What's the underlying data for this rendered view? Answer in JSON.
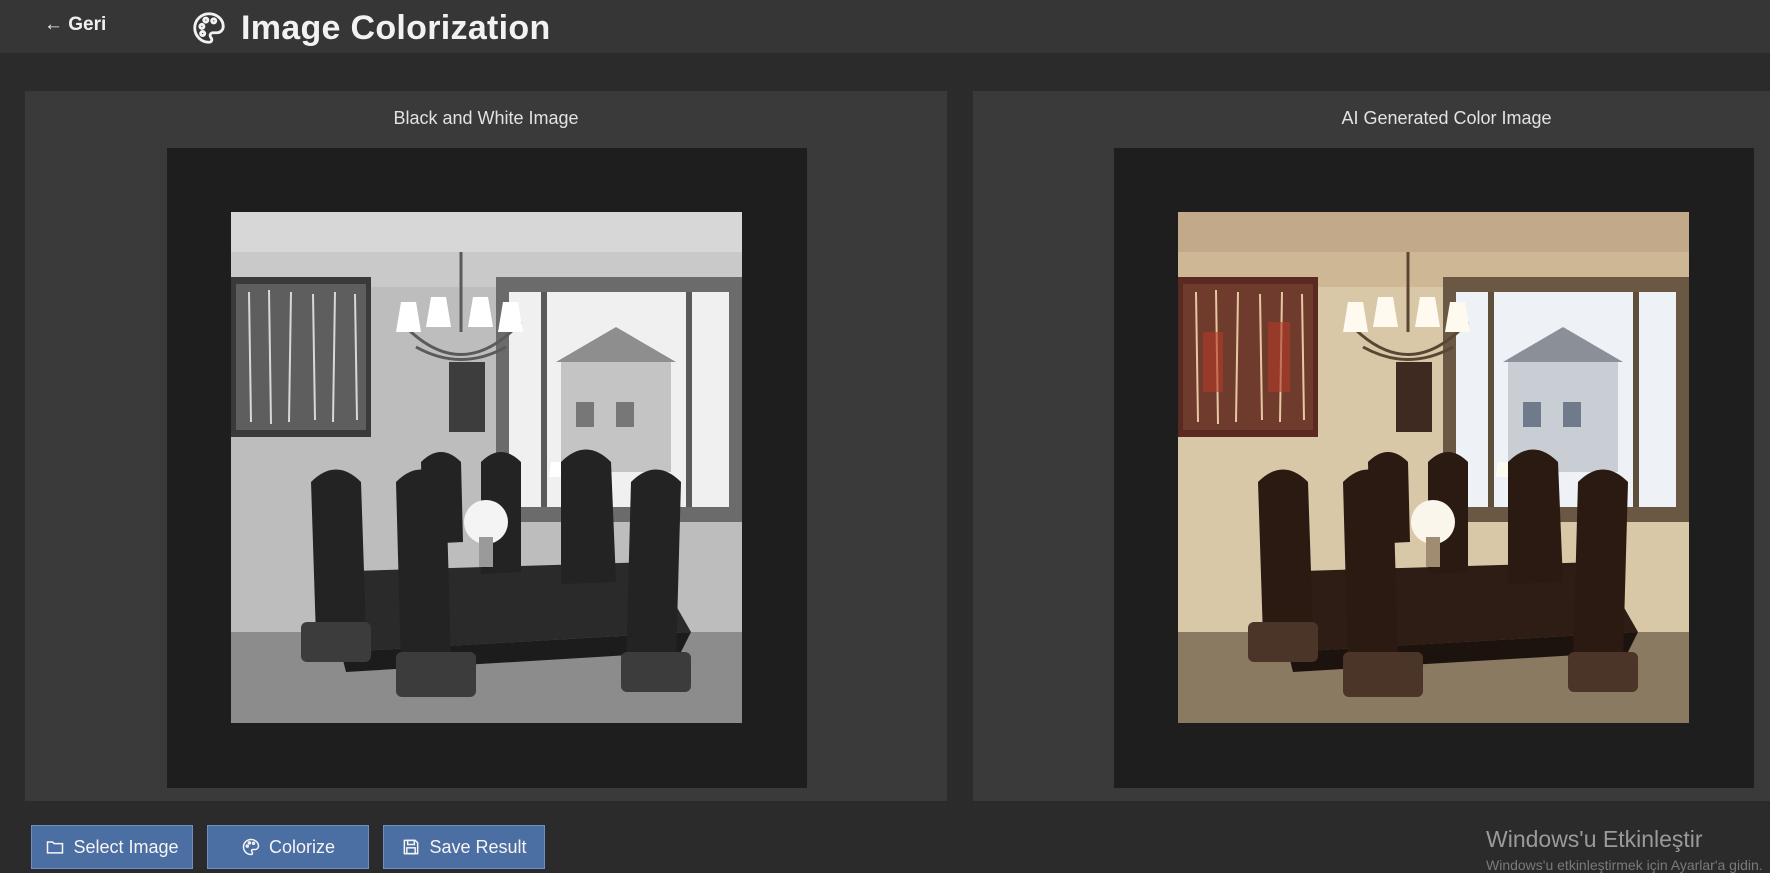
{
  "header": {
    "back_label": "← Geri",
    "title": "Image Colorization",
    "title_icon": "palette-icon"
  },
  "panels": {
    "left_label": "Black and White Image",
    "right_label": "AI Generated Color Image"
  },
  "buttons": {
    "select_label": "Select Image",
    "select_icon": "folder-icon",
    "colorize_label": "Colorize",
    "colorize_icon": "palette-icon",
    "save_label": "Save Result",
    "save_icon": "floppy-disk-icon"
  },
  "watermark": {
    "title": "Windows'u Etkinleştir",
    "subtitle": "Windows'u etkinleştirmek için Ayarlar'a gidin."
  },
  "colors": {
    "background": "#2b2b2b",
    "header": "#363636",
    "panel": "#3a3a3a",
    "frame": "#1e1e1e",
    "button": "#4b6ea3"
  }
}
